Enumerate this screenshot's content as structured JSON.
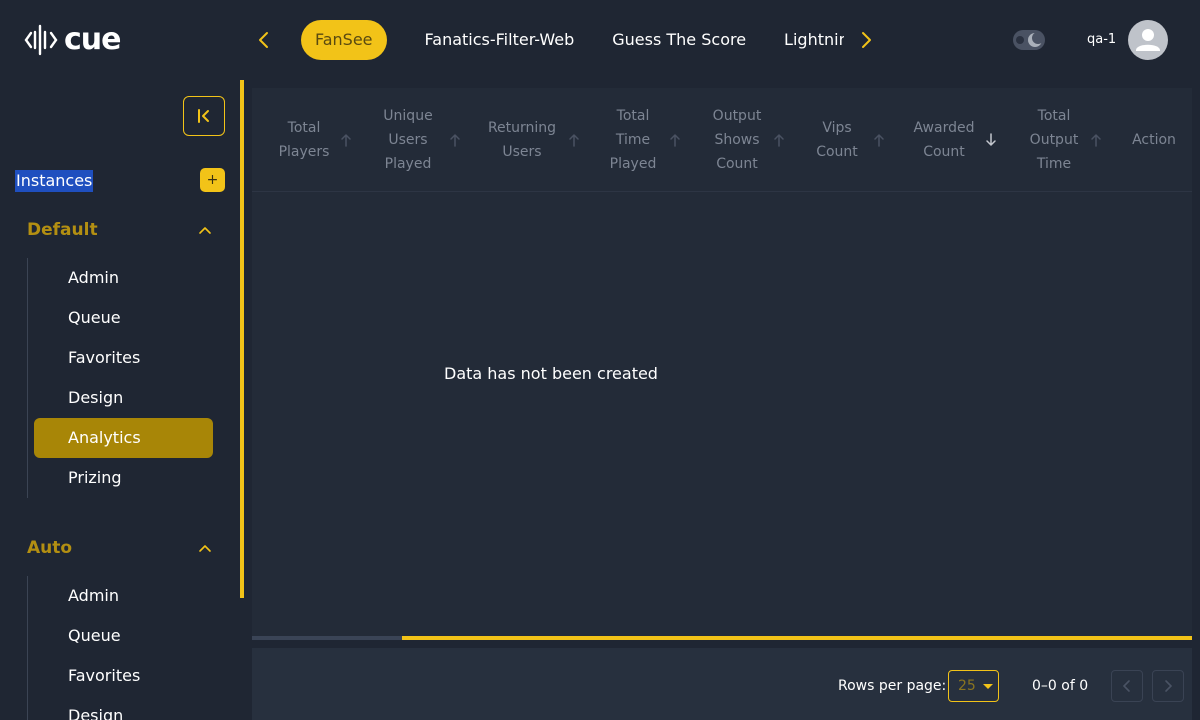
{
  "brand": {
    "logo_text": "cue",
    "accent": "#f2c318"
  },
  "header": {
    "tabs": [
      {
        "label": "FanSee",
        "active": true
      },
      {
        "label": "Fanatics-Filter-Web",
        "active": false
      },
      {
        "label": "Guess The Score",
        "active": false
      },
      {
        "label": "Lightning",
        "active": false
      }
    ],
    "user_name": "qa-1",
    "icons": {
      "prev": "chevron-left-icon",
      "next": "chevron-right-icon",
      "theme": "moon-icon",
      "avatar": "user-icon"
    }
  },
  "sidebar": {
    "instances_label": "Instances",
    "add_label": "+",
    "groups": [
      {
        "title": "Default",
        "items": [
          "Admin",
          "Queue",
          "Favorites",
          "Design",
          "Analytics",
          "Prizing"
        ],
        "active_item": "Analytics"
      },
      {
        "title": "Auto",
        "items": [
          "Admin",
          "Queue",
          "Favorites",
          "Design"
        ]
      }
    ]
  },
  "table": {
    "columns": [
      {
        "label": "Total Players",
        "sort": "none"
      },
      {
        "label": "Unique Users Played",
        "sort": "none"
      },
      {
        "label": "Returning Users",
        "sort": "none"
      },
      {
        "label": "Total Time Played",
        "sort": "none"
      },
      {
        "label": "Output Shows Count",
        "sort": "none"
      },
      {
        "label": "Vips Count",
        "sort": "none"
      },
      {
        "label": "Awarded Count",
        "sort": "desc"
      },
      {
        "label": "Total Output Time",
        "sort": "none"
      },
      {
        "label": "Action",
        "sort": ""
      }
    ],
    "empty_message": "Data has not been created"
  },
  "pagination": {
    "rows_per_page_label": "Rows per page:",
    "rows_per_page": "25",
    "range_text": "0–0 of 0"
  }
}
